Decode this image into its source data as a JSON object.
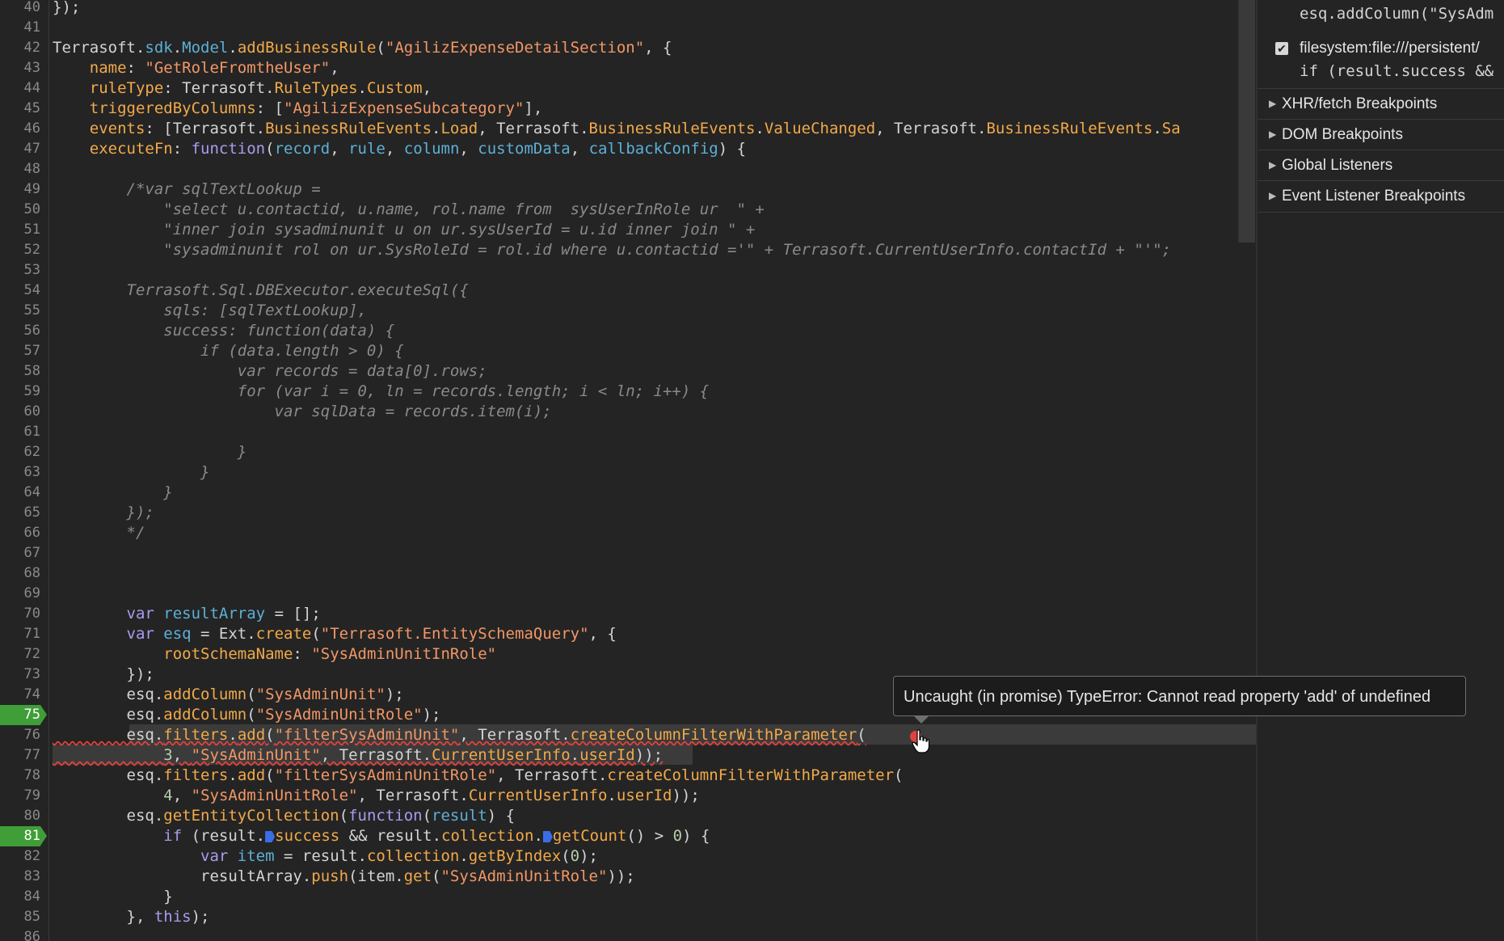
{
  "editor": {
    "line_numbers": [
      "40",
      "41",
      "42",
      "43",
      "44",
      "45",
      "46",
      "47",
      "48",
      "49",
      "50",
      "51",
      "52",
      "53",
      "54",
      "55",
      "56",
      "57",
      "58",
      "59",
      "60",
      "61",
      "62",
      "63",
      "64",
      "65",
      "66",
      "67",
      "68",
      "69",
      "70",
      "71",
      "72",
      "73",
      "74",
      "75",
      "76",
      "77",
      "78",
      "79",
      "80",
      "81",
      "82",
      "83",
      "84",
      "85",
      "86"
    ],
    "breakpoint_lines": [
      "75",
      "81"
    ],
    "code": {
      "l40": "});",
      "l42a": "Terrasoft.",
      "l42b": "sdk",
      "l42c": ".",
      "l42d": "Model",
      "l42e": ".",
      "l42f": "addBusinessRule",
      "l42g": "(",
      "l42h": "\"AgilizExpenseDetailSection\"",
      "l42i": ", {",
      "l43a": "    name",
      "l43b": ": ",
      "l43c": "\"GetRoleFromtheUser\"",
      "l43d": ",",
      "l44a": "    ruleType",
      "l44b": ": Terrasoft.",
      "l44c": "RuleTypes",
      "l44d": ".",
      "l44e": "Custom",
      "l44f": ",",
      "l45a": "    triggeredByColumns",
      "l45b": ": [",
      "l45c": "\"AgilizExpenseSubcategory\"",
      "l45d": "],",
      "l46a": "    events",
      "l46b": ": [Terrasoft.",
      "l46c": "BusinessRuleEvents",
      "l46d": ".",
      "l46e": "Load",
      "l46f": ", Terrasoft.",
      "l46g": "BusinessRuleEvents",
      "l46h": ".",
      "l46i": "ValueChanged",
      "l46j": ", Terrasoft.",
      "l46k": "BusinessRuleEvents",
      "l46l": ".",
      "l46m": "Sa",
      "l47a": "    executeFn",
      "l47b": ": ",
      "l47c": "function",
      "l47d": "(",
      "l47e": "record",
      "l47f": ", ",
      "l47g": "rule",
      "l47h": ", ",
      "l47i": "column",
      "l47j": ", ",
      "l47k": "customData",
      "l47l": ", ",
      "l47m": "callbackConfig",
      "l47n": ") {",
      "l49": "        /*var sqlTextLookup =",
      "l50": "            \"select u.contactid, u.name, rol.name from  sysUserInRole ur  \" +",
      "l51": "            \"inner join sysadminunit u on ur.sysUserId = u.id inner join \" +",
      "l52": "            \"sysadminunit rol on ur.SysRoleId = rol.id where u.contactid ='\" + Terrasoft.CurrentUserInfo.contactId + \"'\";",
      "l54": "        Terrasoft.Sql.DBExecutor.executeSql({",
      "l55": "            sqls: [sqlTextLookup],",
      "l56": "            success: function(data) {",
      "l57": "                if (data.length > 0) {",
      "l58": "                    var records = data[0].rows;",
      "l59": "                    for (var i = 0, ln = records.length; i < ln; i++) {",
      "l60": "                        var sqlData = records.item(i);",
      "l62": "                    }",
      "l63": "                }",
      "l64": "            }",
      "l65": "        });",
      "l66": "        */",
      "l70a": "        var ",
      "l70b": "resultArray",
      "l70c": " = [];",
      "l71a": "        var ",
      "l71b": "esq",
      "l71c": " = Ext.",
      "l71d": "create",
      "l71e": "(",
      "l71f": "\"Terrasoft.EntitySchemaQuery\"",
      "l71g": ", {",
      "l72a": "            rootSchemaName",
      "l72b": ": ",
      "l72c": "\"SysAdminUnitInRole\"",
      "l73": "        });",
      "l74a": "        esq.",
      "l74b": "addColumn",
      "l74c": "(",
      "l74d": "\"SysAdminUnit\"",
      "l74e": ");",
      "l75a": "        esq.",
      "l75b": "addColumn",
      "l75c": "(",
      "l75d": "\"SysAdminUnitRole\"",
      "l75e": ");",
      "l76a": "        esq.",
      "l76b": "filters",
      "l76c": ".",
      "l76d": "add",
      "l76e": "(",
      "l76f": "\"filterSysAdminUnit\"",
      "l76g": ", Terrasoft.",
      "l76h": "createColumnFilterWithParameter",
      "l76i": "(",
      "l77a": "            ",
      "l77b": "3",
      "l77c": ", ",
      "l77d": "\"SysAdminUnit\"",
      "l77e": ", Terrasoft.",
      "l77f": "CurrentUserInfo",
      "l77g": ".",
      "l77h": "userId",
      "l77i": "));",
      "l78a": "        esq.",
      "l78b": "filters",
      "l78c": ".",
      "l78d": "add",
      "l78e": "(",
      "l78f": "\"filterSysAdminUnitRole\"",
      "l78g": ", Terrasoft.",
      "l78h": "createColumnFilterWithParameter",
      "l78i": "(",
      "l79a": "            ",
      "l79b": "4",
      "l79c": ", ",
      "l79d": "\"SysAdminUnitRole\"",
      "l79e": ", Terrasoft.",
      "l79f": "CurrentUserInfo",
      "l79g": ".",
      "l79h": "userId",
      "l79i": "));",
      "l80a": "        esq.",
      "l80b": "getEntityCollection",
      "l80c": "(",
      "l80d": "function",
      "l80e": "(",
      "l80f": "result",
      "l80g": ") {",
      "l81a": "            ",
      "l81b": "if",
      "l81c": " (result.",
      "l81d": "success",
      "l81e": " && result.",
      "l81f": "collection",
      "l81g": ".",
      "l81h": "getCount",
      "l81i": "() > ",
      "l81j": "0",
      "l81k": ") {",
      "l82a": "                ",
      "l82b": "var ",
      "l82c": "item",
      "l82d": " = result.",
      "l82e": "collection",
      "l82f": ".",
      "l82g": "getByIndex",
      "l82h": "(",
      "l82i": "0",
      "l82j": ");",
      "l83a": "                resultArray.",
      "l83b": "push",
      "l83c": "(item.",
      "l83d": "get",
      "l83e": "(",
      "l83f": "\"SysAdminUnitRole\"",
      "l83g": "));",
      "l84": "            }",
      "l85a": "        }, ",
      "l85b": "this",
      "l85c": ");"
    }
  },
  "tooltip": {
    "text": "Uncaught (in promise) TypeError: Cannot read property 'add' of undefined"
  },
  "sidebar": {
    "bp1_code": "esq.addColumn(\"SysAdm",
    "bp2_file": "filesystem:file:///persistent/",
    "bp2_code": "if (result.success &&",
    "sections": [
      "XHR/fetch Breakpoints",
      "DOM Breakpoints",
      "Global Listeners",
      "Event Listener Breakpoints"
    ]
  },
  "colors": {
    "keyword": "#a89cf0",
    "string": "#f29766",
    "property": "#5db0d7",
    "method": "#f2a94a",
    "comment": "#8a8a8a",
    "breakpoint": "#3f9e37",
    "error": "#e0413d"
  }
}
